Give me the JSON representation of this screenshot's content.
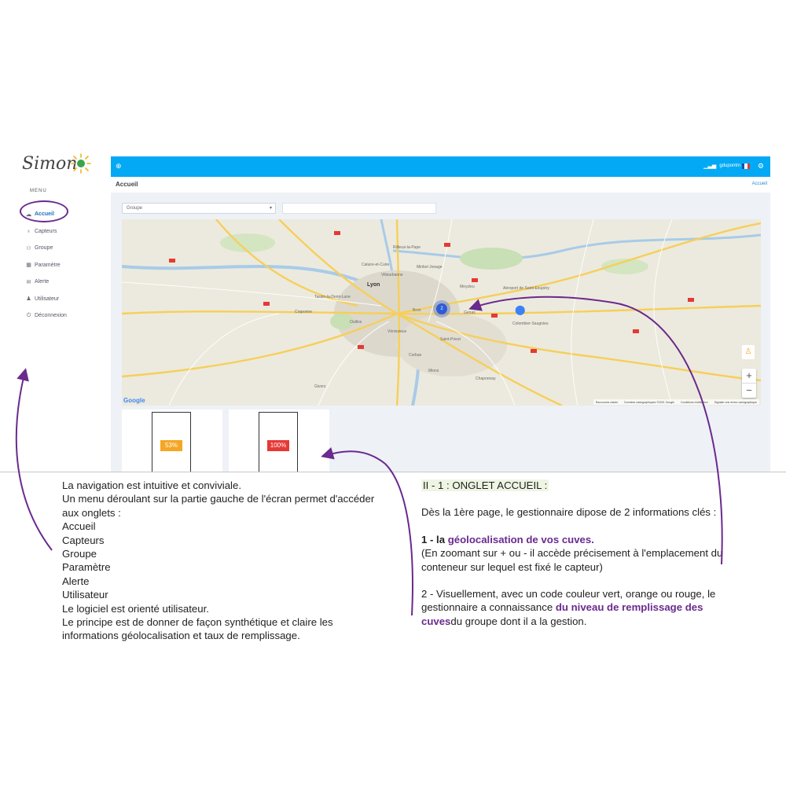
{
  "app": {
    "logo_text": "Simon",
    "menu_title": "MENU",
    "menu": [
      {
        "label": "Accueil",
        "icon": "cloud-icon"
      },
      {
        "label": "Capteurs",
        "icon": "bulb-icon"
      },
      {
        "label": "Groupe",
        "icon": "group-icon"
      },
      {
        "label": "Paramètre",
        "icon": "grid-icon"
      },
      {
        "label": "Alerte",
        "icon": "alert-icon"
      },
      {
        "label": "Utilisateur",
        "icon": "user-icon"
      },
      {
        "label": "Déconnexion",
        "icon": "power-icon"
      }
    ],
    "active_index": 0,
    "topbar": {
      "user": "gdupontm"
    },
    "page_title": "Accueil",
    "breadcrumb": "Accueil",
    "group_select": {
      "value": "Groupe"
    },
    "colors": {
      "topbar": "#03a9f4",
      "accent": "#6a2a8e",
      "orange": "#f5a623",
      "red": "#e53935"
    }
  },
  "map": {
    "labels": {
      "lyon": "Lyon",
      "villeurbanne": "Villeurbanne",
      "caluire": "Caluire-et-Cuire",
      "rillieux": "Rillieux-la-Pape",
      "miribel": "Miribel Jonage",
      "meyzieu": "Meyzieu",
      "bron": "Bron",
      "venissieux": "Vénissieux",
      "aeroport": "Aéroport de Saint-Exupéry",
      "colombier": "Colombier-Saugnieu",
      "genas": "Genas",
      "oullins": "Oullins",
      "corbas": "Corbas",
      "stpriest": "Saint-Priest",
      "mions": "Mions",
      "chaponnay": "Chaponnay",
      "givors": "Givors",
      "craponne": "Craponne",
      "tassin": "Tassin-la-Demi-Lune"
    },
    "cluster_count": "2",
    "google": "Google",
    "footer": [
      "Raccourcis clavier",
      "Données cartographiques ©2021 Google",
      "Conditions d'utilisation",
      "Signaler une erreur cartographique"
    ]
  },
  "tanks": [
    {
      "label": "53%",
      "level": 53,
      "color": "#f5a623"
    },
    {
      "label": "100%",
      "level": 100,
      "color": "#e53935"
    }
  ],
  "text": {
    "left": [
      "La navigation est intuitive et conviviale.",
      "Un menu déroulant sur la partie gauche de l'écran permet d'accéder aux onglets :",
      "Accueil",
      "Capteurs",
      "Groupe",
      "Paramètre",
      "Alerte",
      "Utilisateur",
      "Le logiciel est orienté utilisateur.",
      "Le principe est de donner de façon synthétique et claire les informations géolocalisation et taux de remplissage."
    ],
    "right": {
      "heading": "II - 1 : ONGLET ACCUEIL :",
      "intro": "Dès la 1ère page, le gestionnaire dipose de 2 informations clés :",
      "item1_prefix": "1 - la ",
      "item1_highlight": "géolocalisation de vos cuves.",
      "item1_body": "(En zoomant sur + ou - il accède précisement à l'emplacement du conteneur sur lequel est fixé le capteur)",
      "item2_prefix": "2 - Visuellement, avec un code couleur vert, orange ou rouge, le gestionnaire a connaissance ",
      "item2_highlight": "du niveau de remplissage des cuves",
      "item2_suffix": "du groupe dont il a la gestion."
    }
  }
}
